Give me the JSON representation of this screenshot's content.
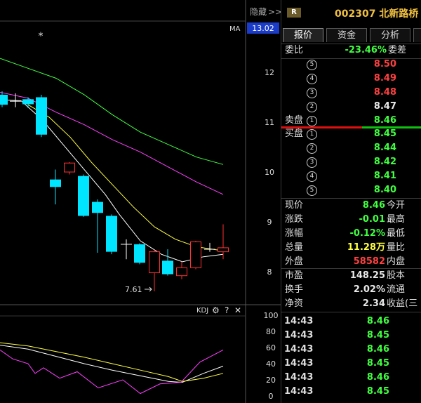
{
  "chart": {
    "hide_label": "隐藏",
    "hide_arrows": ">>",
    "ma_label": "MA",
    "price_now_tag": "13.02",
    "y_labels": [
      "12",
      "11",
      "10",
      "9",
      "8"
    ],
    "star_marker": "*",
    "low_label": "7.61",
    "kdj_label": "KDJ",
    "kdj_y_labels": [
      "100",
      "80",
      "60",
      "40",
      "20",
      "0"
    ]
  },
  "stock": {
    "badge": "R",
    "title": "002307 北新路桥"
  },
  "tabs": [
    {
      "label": "报价"
    },
    {
      "label": "资金"
    },
    {
      "label": "分析"
    }
  ],
  "committee": {
    "label": "委比",
    "value": "-23.46%",
    "label2": "委差"
  },
  "asks": [
    {
      "idx": "5",
      "price": "8.50",
      "color": "red"
    },
    {
      "idx": "4",
      "price": "8.49",
      "color": "red"
    },
    {
      "idx": "3",
      "price": "8.48",
      "color": "red"
    },
    {
      "idx": "2",
      "price": "8.47",
      "color": "white"
    },
    {
      "idx": "1",
      "price": "8.46",
      "color": "green",
      "label": "卖盘"
    }
  ],
  "bids": [
    {
      "idx": "1",
      "price": "8.45",
      "color": "green",
      "label": "买盘"
    },
    {
      "idx": "2",
      "price": "8.44",
      "color": "green"
    },
    {
      "idx": "3",
      "price": "8.42",
      "color": "green"
    },
    {
      "idx": "4",
      "price": "8.41",
      "color": "green"
    },
    {
      "idx": "5",
      "price": "8.40",
      "color": "green"
    }
  ],
  "quote": [
    {
      "label": "现价",
      "value": "8.46",
      "color": "green",
      "label2": "今开"
    },
    {
      "label": "涨跌",
      "value": "-0.01",
      "color": "green",
      "label2": "最高"
    },
    {
      "label": "涨幅",
      "value": "-0.12%",
      "color": "green",
      "label2": "最低"
    },
    {
      "label": "总量",
      "value": "11.28万",
      "color": "yellow",
      "label2": "量比"
    },
    {
      "label": "外盘",
      "value": "58582",
      "color": "red",
      "label2": "内盘"
    }
  ],
  "fund": [
    {
      "label": "市盈",
      "value": "148.25",
      "label2": "股本"
    },
    {
      "label": "换手",
      "value": "2.02%",
      "label2": "流通"
    },
    {
      "label": "净资",
      "value": "2.34",
      "label2": "收益(三"
    }
  ],
  "ticks": [
    {
      "time": "14:43",
      "price": "8.46"
    },
    {
      "time": "14:43",
      "price": "8.45"
    },
    {
      "time": "14:43",
      "price": "8.46"
    },
    {
      "time": "14:43",
      "price": "8.45"
    },
    {
      "time": "14:43",
      "price": "8.46"
    },
    {
      "time": "14:43",
      "price": "8.45"
    }
  ],
  "colors": {
    "up": "#ff3030",
    "down": "#00e5ff",
    "ma5": "#ffffff",
    "ma10": "#ffff40",
    "ma20": "#ff40ff",
    "ma60": "#40ff40"
  }
}
